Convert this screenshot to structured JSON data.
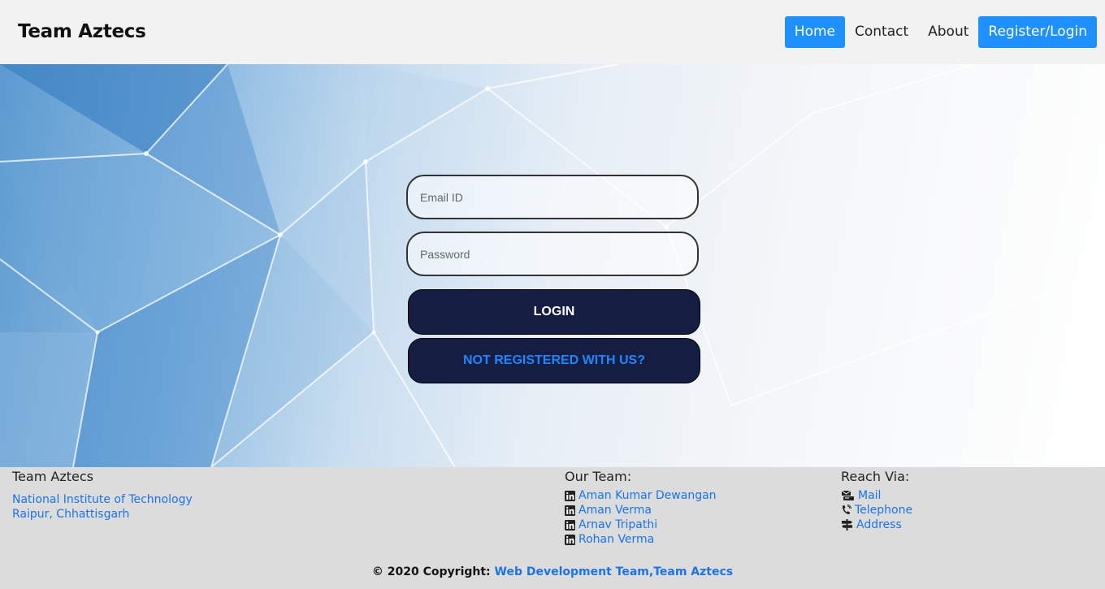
{
  "header": {
    "brand": "Team Aztecs",
    "nav": [
      {
        "label": "Home"
      },
      {
        "label": "Contact"
      },
      {
        "label": "About"
      },
      {
        "label": "Register/Login"
      }
    ]
  },
  "form": {
    "email_placeholder": "Email ID",
    "password_placeholder": "Password",
    "login_label": "LOGIN",
    "not_registered_label": "NOT REGISTERED WITH US?"
  },
  "footer": {
    "org": {
      "title": "Team Aztecs",
      "line1": "National Institute of Technology",
      "line2": "Raipur, Chhattisgarh"
    },
    "team": {
      "title": "Our Team:",
      "members": [
        "Aman Kumar Dewangan",
        "Aman Verma",
        "Arnav Tripathi",
        "Rohan Verma"
      ]
    },
    "reach": {
      "title": "Reach Via:",
      "items": [
        "Mail",
        "Telephone",
        "Address"
      ]
    },
    "copyright_prefix": "© 2020 Copyright:",
    "copyright_link": "Web Development Team,Team Aztecs"
  },
  "colors": {
    "accent": "#1e90ff",
    "button_bg": "#161d42",
    "link": "#1a73e8"
  },
  "icons": {
    "team": "linkedin-icon",
    "mail": "mail-icon",
    "telephone": "telephone-icon",
    "address": "signpost-icon"
  }
}
